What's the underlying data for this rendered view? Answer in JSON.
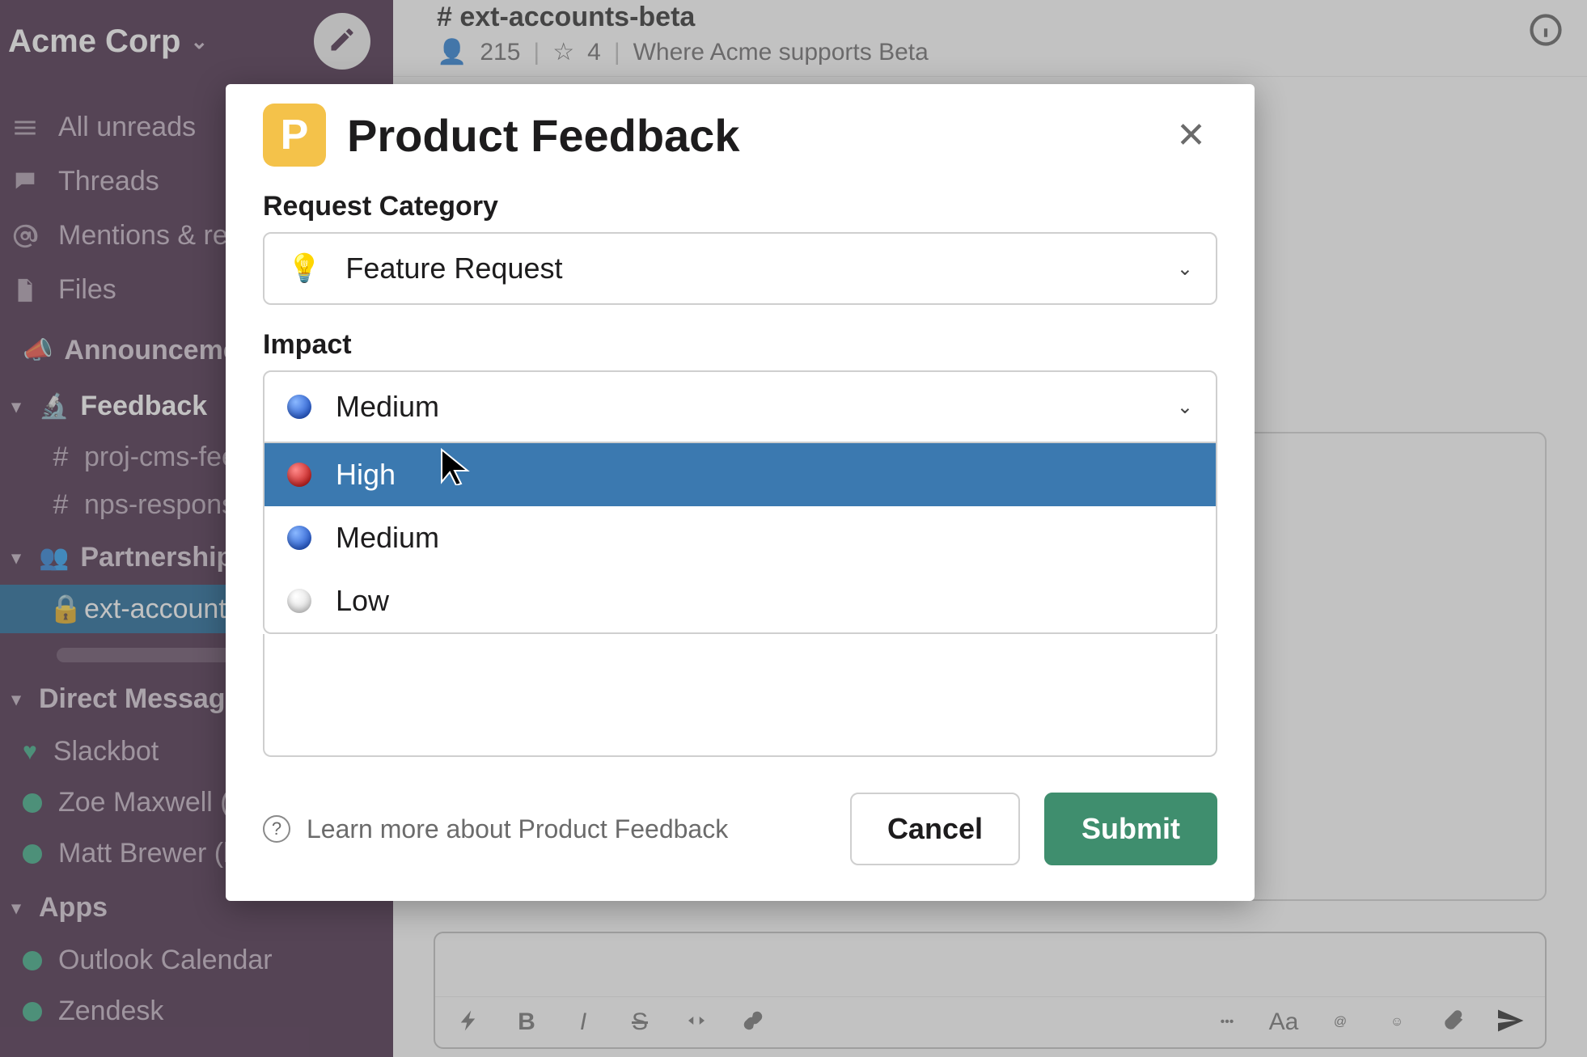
{
  "workspace": {
    "name": "Acme Corp"
  },
  "sidebar": {
    "nav": [
      {
        "label": "All unreads",
        "icon": "hash-lines-icon"
      },
      {
        "label": "Threads",
        "icon": "threads-icon"
      },
      {
        "label": "Mentions & reactions",
        "icon": "mention-icon"
      },
      {
        "label": "Files",
        "icon": "file-icon"
      }
    ],
    "sections": [
      {
        "name": "Announcements",
        "emoji": "📣",
        "collapsible": false,
        "channels": []
      },
      {
        "name": "Feedback",
        "emoji": "🔬",
        "collapsible": true,
        "channels": [
          {
            "prefix": "#",
            "label": "proj-cms-feedback",
            "active": false
          },
          {
            "prefix": "#",
            "label": "nps-responses",
            "active": false
          }
        ]
      },
      {
        "name": "Partnerships",
        "emoji": "👥",
        "collapsible": true,
        "channels": [
          {
            "prefix": "lock",
            "label": "ext-accounts-beta",
            "active": true
          }
        ]
      }
    ],
    "dm_header": "Direct Messages",
    "dms": [
      {
        "label": "Slackbot",
        "heart": true
      },
      {
        "label": "Zoe Maxwell (she/her)",
        "heart": false
      },
      {
        "label": "Matt Brewer (he/him)",
        "heart": false
      }
    ],
    "apps_header": "Apps",
    "apps": [
      {
        "label": "Outlook Calendar"
      },
      {
        "label": "Zendesk"
      }
    ]
  },
  "channel": {
    "name": "# ext-accounts-beta",
    "members": "215",
    "pins": "4",
    "topic": "Where Acme supports Beta"
  },
  "modal": {
    "badge_letter": "P",
    "title": "Product Feedback",
    "field1_label": "Request Category",
    "field1_value": "Feature Request",
    "field1_icon": "💡",
    "field2_label": "Impact",
    "field2_value": "Medium",
    "field2_options": [
      {
        "label": "High",
        "dot": "dot-red",
        "hovered": true
      },
      {
        "label": "Medium",
        "dot": "dot-blue",
        "hovered": false
      },
      {
        "label": "Low",
        "dot": "dot-white",
        "hovered": false
      }
    ],
    "learn_more": "Learn more about Product Feedback",
    "cancel": "Cancel",
    "submit": "Submit"
  },
  "colors": {
    "sidebar_bg": "#3a1a3a",
    "active_bg": "#0a5a8f",
    "submit_bg": "#3f8e6e",
    "badge_bg": "#f4c24a",
    "dd_hover": "#3b79b0"
  }
}
